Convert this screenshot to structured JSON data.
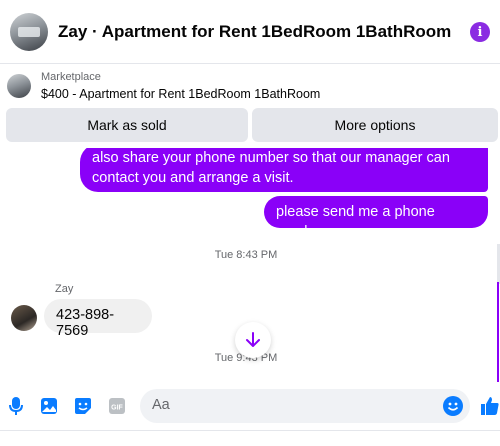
{
  "header": {
    "title": "Zay · Apartment for Rent 1BedRoom 1BathRoom",
    "info_icon": "info-icon"
  },
  "marketplace": {
    "label": "Marketplace",
    "item": "$400 - Apartment for Rent 1BedRoom 1BathRoom"
  },
  "actions": {
    "mark_sold": "Mark as sold",
    "more_options": "More options"
  },
  "chat": {
    "messages_out": [
      "also share your phone number so that our manager can contact you and arrange a visit.",
      "please send me a phone number"
    ],
    "time_1": "Tue 8:43 PM",
    "sender_name": "Zay",
    "message_in": "423-898-7569",
    "time_2": "Tue 9:43 PM"
  },
  "composer": {
    "placeholder": "Aa",
    "icons": [
      "microphone-icon",
      "photo-icon",
      "sticker-icon",
      "gif-icon",
      "emoji-icon",
      "thumbs-up-icon"
    ]
  },
  "colors": {
    "accent": "#8a00f8",
    "blue": "#0a7cff",
    "bubble_in": "#f0f0f0",
    "button_bg": "#e4e6eb"
  }
}
